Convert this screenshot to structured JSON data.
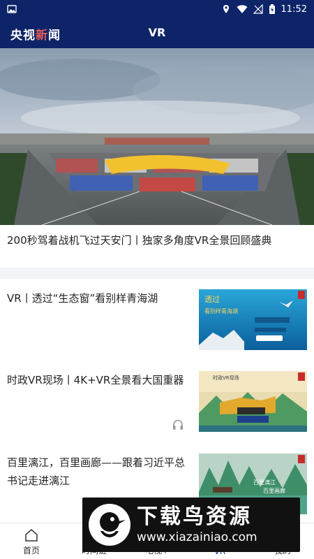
{
  "status_bar": {
    "time": "11:52"
  },
  "app_bar": {
    "brand_part1": "央视",
    "brand_part2": "新",
    "brand_part3": "闻",
    "section_title": "VR"
  },
  "hero": {
    "title": "200秒驾着战机飞过天安门丨独家多角度VR全景回顾盛典"
  },
  "list": [
    {
      "title": "VR丨透过“生态窗”看别样青海湖",
      "has_audio": false
    },
    {
      "title": "时政VR现场丨4K+VR全景看大国重器",
      "has_audio": true
    },
    {
      "title": "百里漓江，百里画廊——跟着习近平总书记走进漓江",
      "has_audio": false
    }
  ],
  "bottom_nav": [
    {
      "label": "首页",
      "icon": "home-icon",
      "active": false
    },
    {
      "label": "时间链",
      "icon": "timeline-icon",
      "active": false
    },
    {
      "label": "电视+",
      "icon": "tv-icon",
      "active": false
    },
    {
      "label": "VR",
      "icon": "vr-icon",
      "active": true
    },
    {
      "label": "我的",
      "icon": "profile-icon",
      "active": false
    }
  ],
  "watermark": {
    "text": "下载鸟资源",
    "url": "www.xiazainiao.com"
  },
  "colors": {
    "header": "#0e2468",
    "brand_accent": "#e05a5a",
    "active_tab": "#1a3d9a"
  }
}
